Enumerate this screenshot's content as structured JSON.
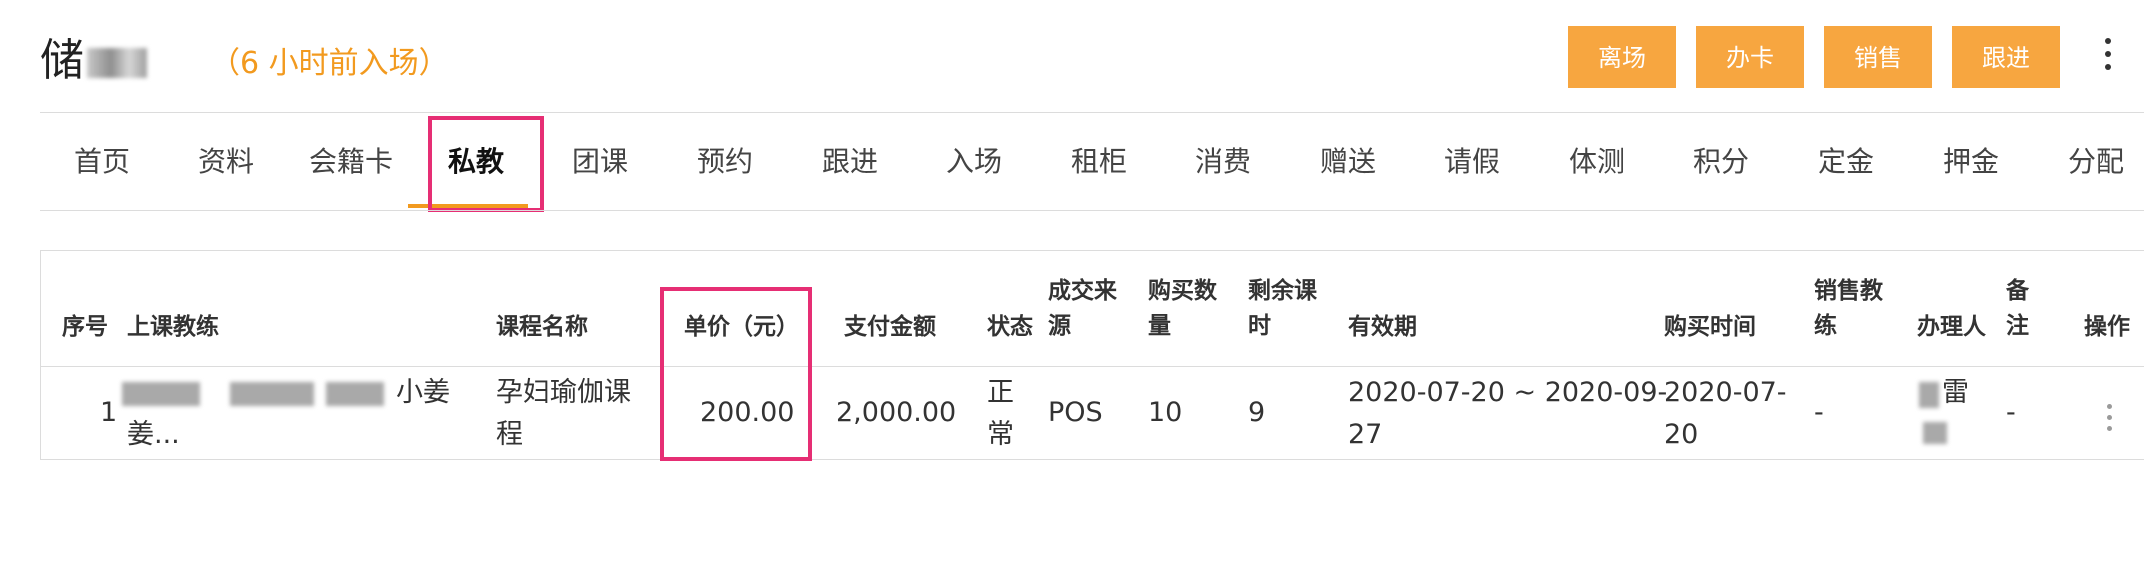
{
  "header": {
    "member_name": "储",
    "entry_time": "（6 小时前入场）",
    "buttons": {
      "leave": "离场",
      "card": "办卡",
      "sales": "销售",
      "follow": "跟进"
    }
  },
  "tabs": [
    "首页",
    "资料",
    "会籍卡",
    "私教",
    "团课",
    "预约",
    "跟进",
    "入场",
    "租柜",
    "消费",
    "赠送",
    "请假",
    "体测",
    "积分",
    "定金",
    "押金",
    "分配"
  ],
  "active_tab": "私教",
  "table": {
    "headers": {
      "index": "序号",
      "coach": "上课教练",
      "course": "课程名称",
      "unit_price": "单价（元）",
      "paid": "支付金额",
      "status": "状态",
      "source_1": "成交来",
      "source_2": "源",
      "qty_1": "购买数",
      "qty_2": "量",
      "remain_1": "剩余课",
      "remain_2": "时",
      "validity": "有效期",
      "purchase_time": "购买时间",
      "sales_coach_1": "销售教",
      "sales_coach_2": "练",
      "handler": "办理人",
      "remark_1": "备",
      "remark_2": "注",
      "action": "操作"
    },
    "rows": [
      {
        "index": "1",
        "coach_1": "小姜",
        "coach_2": "姜...",
        "course_1": "孕妇瑜伽课",
        "course_2": "程",
        "unit_price": "200.00",
        "paid": "2,000.00",
        "status_1": "正",
        "status_2": "常",
        "source": "POS",
        "qty": "10",
        "remain": "9",
        "validity_1": "2020-07-20 ~ 2020-09-",
        "validity_2": "27",
        "purchase_1": "2020-07-",
        "purchase_2": "20",
        "sales_coach": "-",
        "handler_1": "雷",
        "remark": "-"
      }
    ]
  },
  "colors": {
    "accent": "#f7a640",
    "entry_text": "#f29a1f",
    "highlight": "#e62e74"
  }
}
